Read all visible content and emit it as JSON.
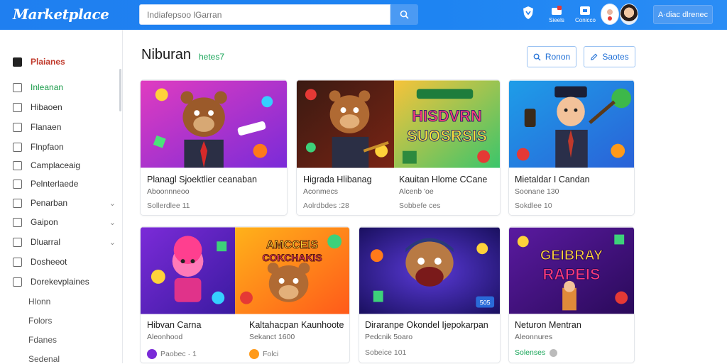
{
  "header": {
    "logo": "Marketplace",
    "search_placeholder": "Indiafepsoo lGarran",
    "icons": [
      {
        "name": "shield-icon",
        "label": ""
      },
      {
        "name": "gift-icon",
        "label": "Sieels"
      },
      {
        "name": "store-icon",
        "label": "Conicco"
      }
    ],
    "action_button": "A·diac dlrenec"
  },
  "sidebar": {
    "items": [
      {
        "label": "Plaianes",
        "icon": "home-icon"
      },
      {
        "label": "Inleanan",
        "icon": "tag-icon"
      },
      {
        "label": "Hibaoen",
        "icon": "people-icon"
      },
      {
        "label": "Flanaen",
        "icon": "image-icon"
      },
      {
        "label": "Flnpfaon",
        "icon": "document-icon"
      },
      {
        "label": "Camplaceaig",
        "icon": "layers-icon"
      },
      {
        "label": "Pelnterlaede",
        "icon": "doc-icon"
      },
      {
        "label": "Penarban",
        "icon": "card-icon",
        "chevron": true
      },
      {
        "label": "Gaipon",
        "icon": "gear-icon",
        "chevron": true
      },
      {
        "label": "Dluarral",
        "icon": "folder-icon",
        "chevron": true
      },
      {
        "label": "Dosheeot",
        "icon": "file-icon"
      },
      {
        "label": "Dorekevplaines",
        "icon": "home-icon"
      }
    ],
    "subitems": [
      "Hlonn",
      "Folors",
      "Fdanes",
      "Sedenal"
    ]
  },
  "main": {
    "title": "Niburan",
    "badge": "hetes7",
    "buttons": [
      {
        "label": "Ronon",
        "icon": "search-icon"
      },
      {
        "label": "Saotes",
        "icon": "edit-icon"
      }
    ],
    "cards": [
      {
        "title": "Planagl Sjoektlier ceanaban",
        "subtitle": "Aboonnneoo",
        "meta": "Sollerdlee 11",
        "thumb_text": ""
      },
      {
        "title": "Higrada Hlibanag",
        "subtitle": "Aconmecs",
        "meta": "Aolrdbdes :28",
        "thumb_text": ""
      },
      {
        "title": "Kauitan Hlome CCane",
        "subtitle": "Alcenb 'oe",
        "meta": "Sobbefe ces",
        "thumb_text": "HISDVRN SUOSRSIS"
      },
      {
        "title": "Mietaldar I Candan",
        "subtitle": "Soonane 130",
        "meta": "Sokdlee 10",
        "thumb_text": ""
      },
      {
        "title": "Hibvan Carna",
        "subtitle": "Aleonhood",
        "meta": "Paobec · 1",
        "thumb_text": ""
      },
      {
        "title": "Kaltahacpan Kaunhoote",
        "subtitle": "Sekanct 1600",
        "meta": "Folci",
        "thumb_text": "AMCCEIS COKCHAKIS"
      },
      {
        "title": "Diraranpe Okondel Ijepokarpan",
        "subtitle": "Pedcnik 5oaro",
        "meta": "Sobeice 101",
        "thumb_text": "505"
      },
      {
        "title": "Neturon Mentran",
        "subtitle": "Aleonnures",
        "meta": "Solenses",
        "thumb_text": "GEIBRAY RAPEIS"
      }
    ]
  }
}
